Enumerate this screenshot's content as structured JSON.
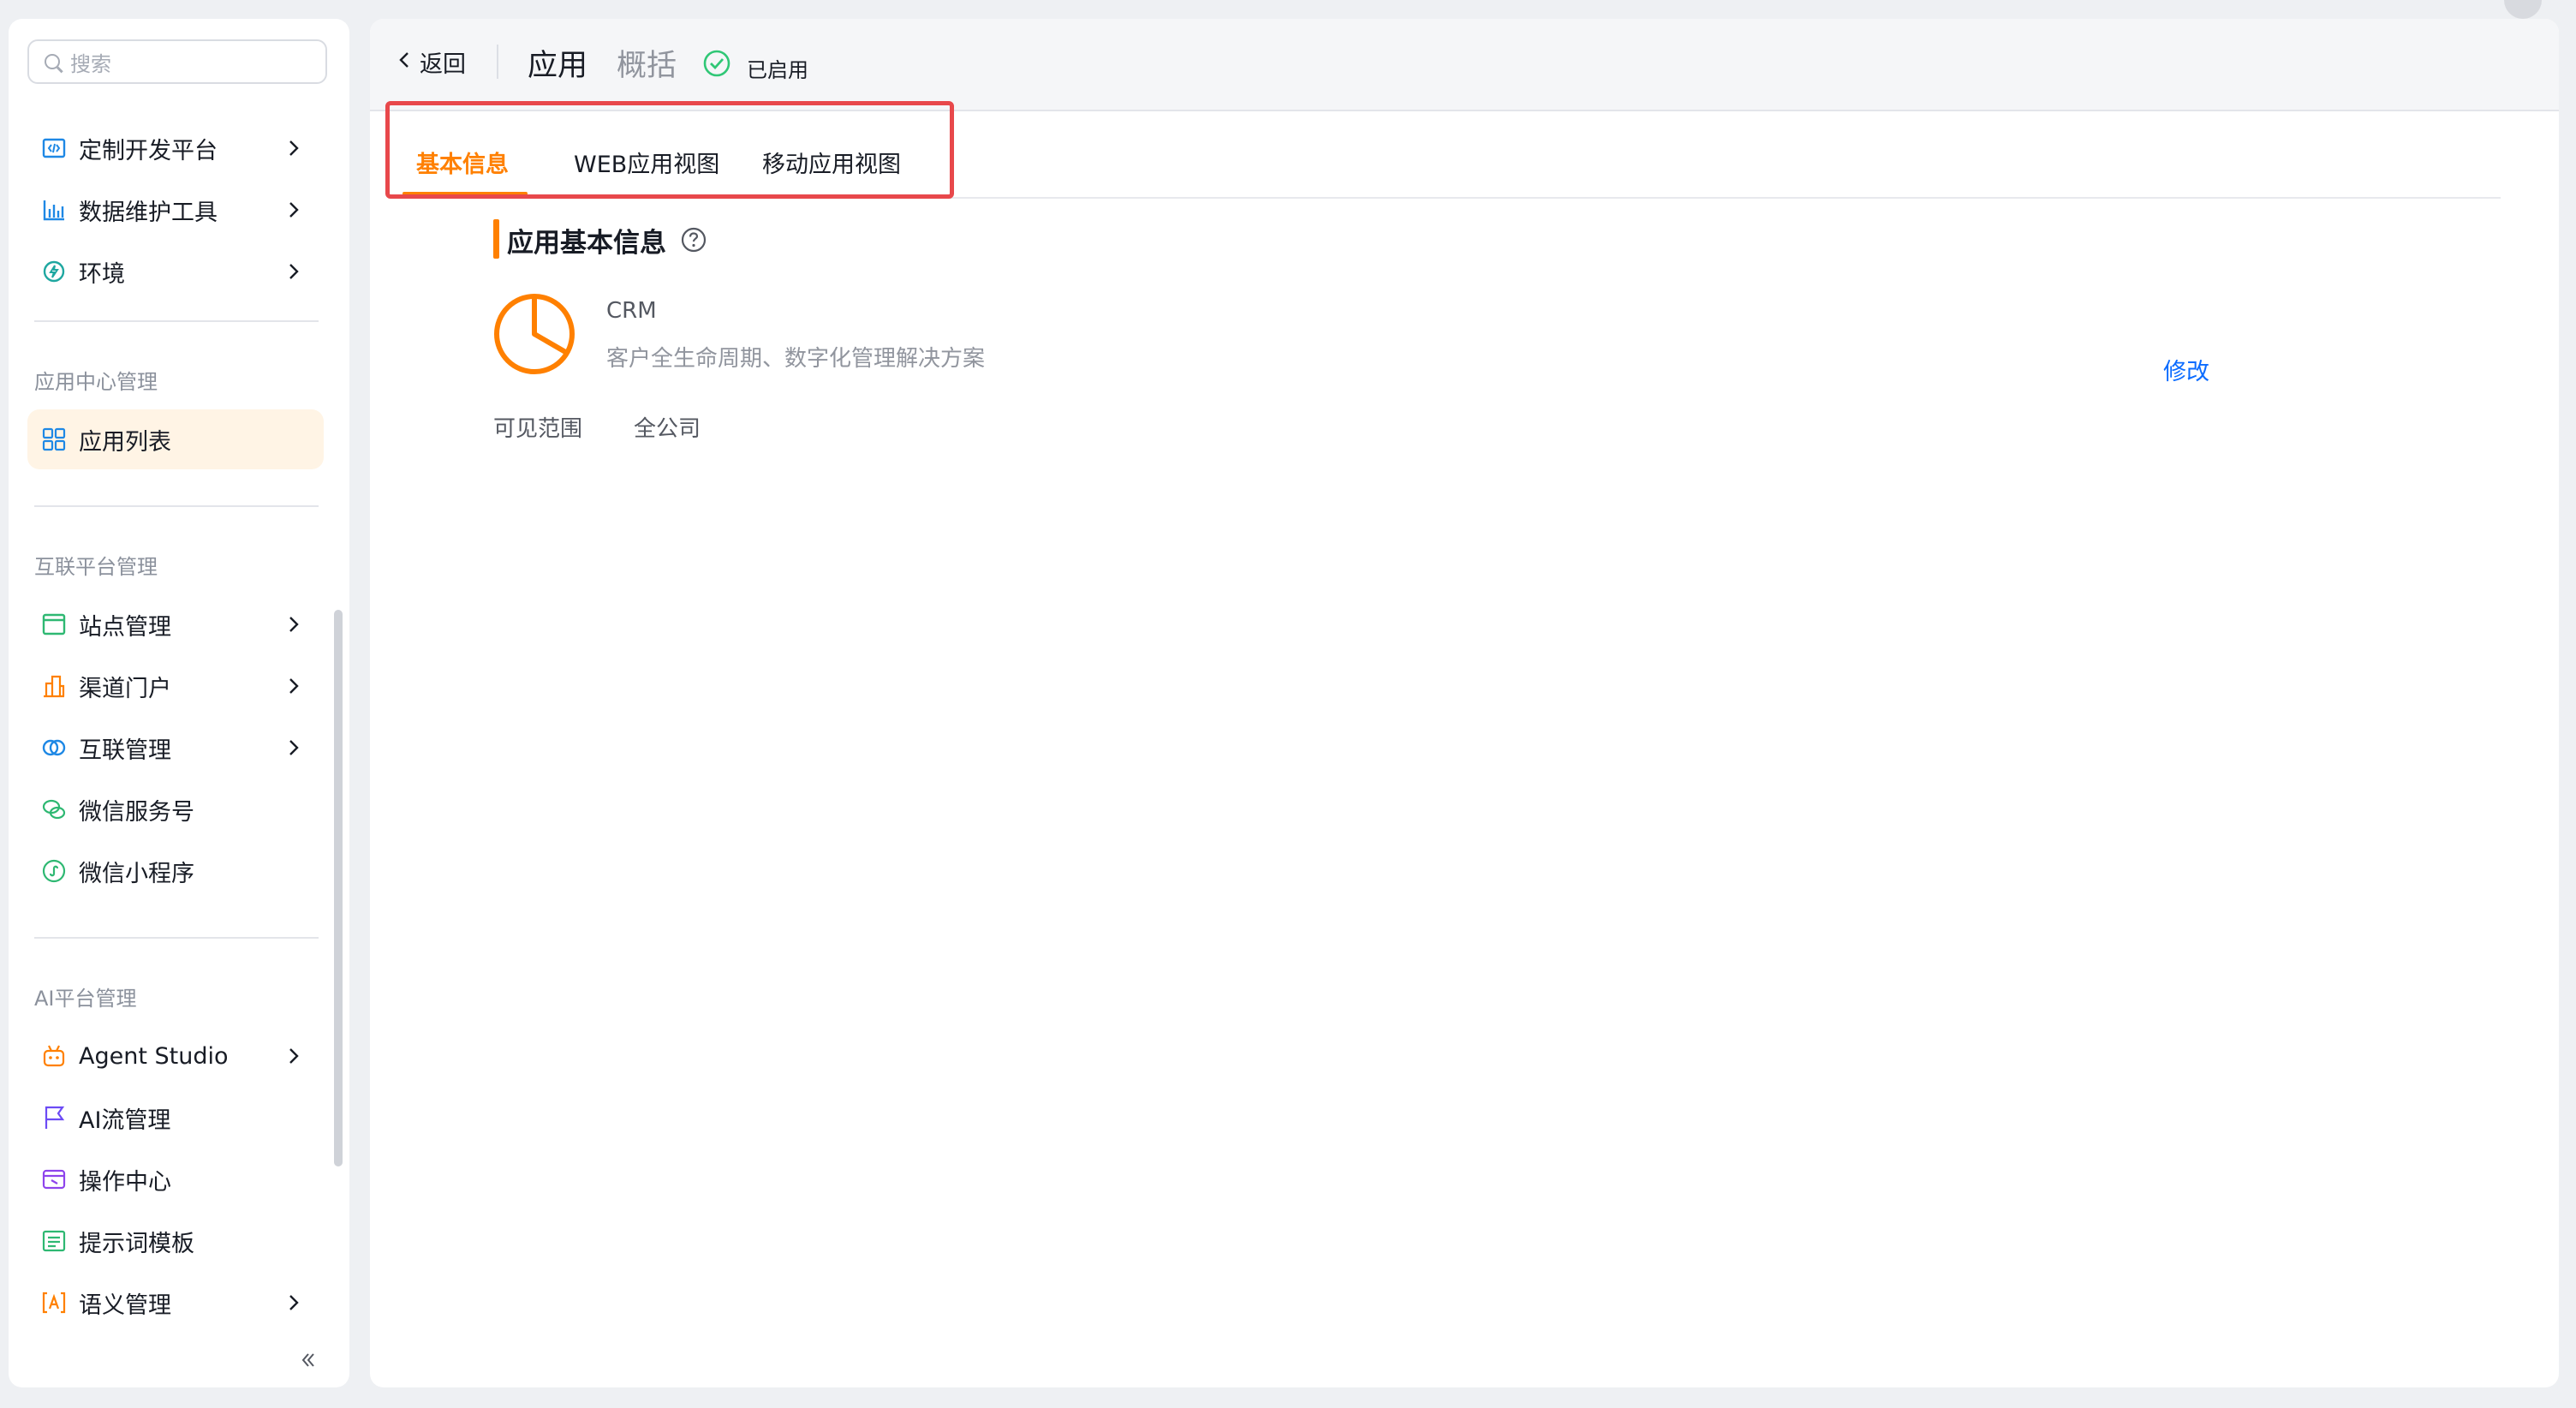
{
  "search": {
    "placeholder": "搜索"
  },
  "sidebar": {
    "group1": [
      {
        "label": "定制开发平台",
        "icon": "code-window-icon"
      },
      {
        "label": "数据维护工具",
        "icon": "bar-chart-icon"
      },
      {
        "label": "环境",
        "icon": "lightning-icon"
      }
    ],
    "section_app_center": "应用中心管理",
    "app_list_label": "应用列表",
    "section_interconnect": "互联平台管理",
    "group3": [
      {
        "label": "站点管理",
        "icon": "site-icon"
      },
      {
        "label": "渠道门户",
        "icon": "building-icon"
      },
      {
        "label": "互联管理",
        "icon": "link-rings-icon"
      },
      {
        "label": "微信服务号",
        "icon": "wechat-icon"
      },
      {
        "label": "微信小程序",
        "icon": "mini-program-icon"
      }
    ],
    "section_ai": "AI平台管理",
    "group4": [
      {
        "label": "Agent Studio",
        "icon": "robot-icon"
      },
      {
        "label": "AI流管理",
        "icon": "flag-icon"
      },
      {
        "label": "操作中心",
        "icon": "operation-icon"
      },
      {
        "label": "提示词模板",
        "icon": "template-icon"
      },
      {
        "label": "语义管理",
        "icon": "semantic-icon"
      }
    ]
  },
  "header": {
    "back_label": "返回",
    "app_title": "应用",
    "overview_label": "概括",
    "status_label": "已启用"
  },
  "tabs": [
    {
      "label": "基本信息",
      "active": true
    },
    {
      "label": "WEB应用视图",
      "active": false
    },
    {
      "label": "移动应用视图",
      "active": false
    }
  ],
  "section": {
    "title": "应用基本信息"
  },
  "app": {
    "name": "CRM",
    "description": "客户全生命周期、数字化管理解决方案",
    "edit_label": "修改"
  },
  "visibility": {
    "label": "可见范围",
    "value": "全公司"
  },
  "colors": {
    "accent": "#ff8000",
    "link": "#0c6cff",
    "highlight_border": "#e8484b",
    "status_green": "#30c776"
  }
}
